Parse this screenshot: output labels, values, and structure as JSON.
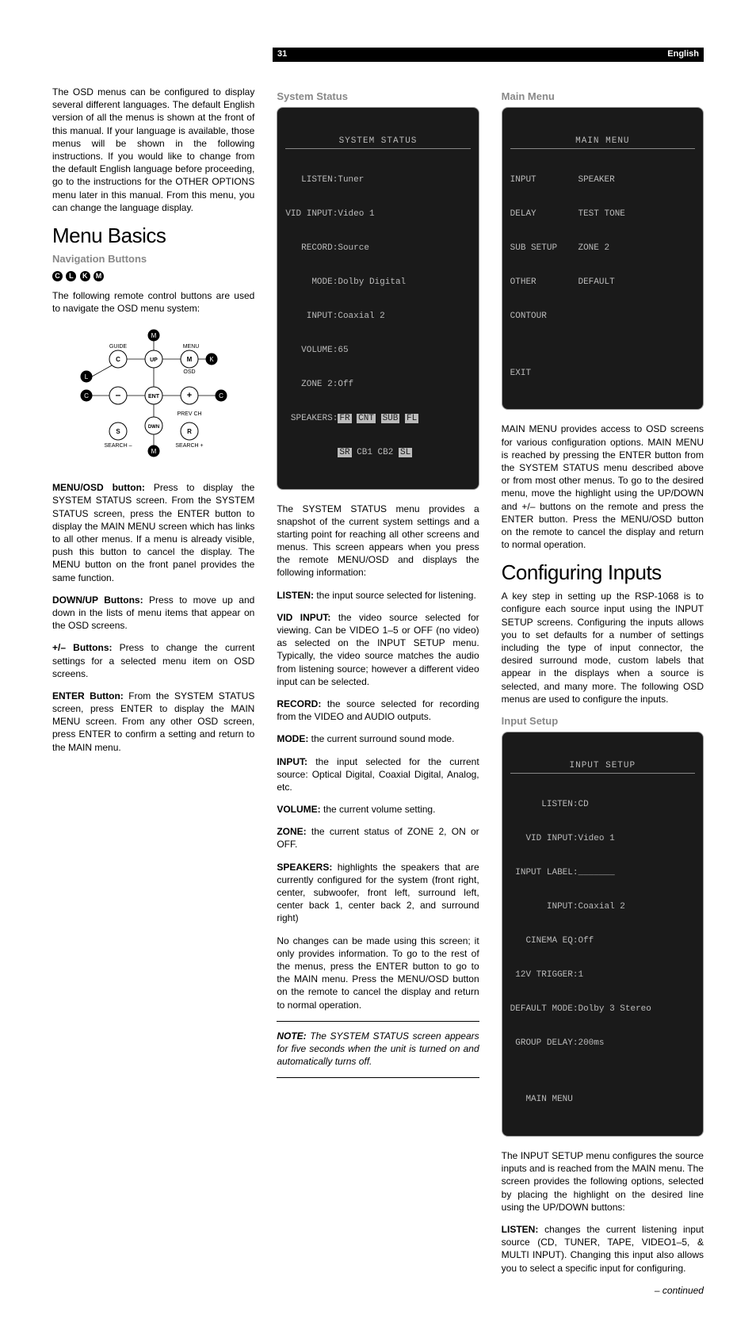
{
  "header": {
    "page_num": "31",
    "language": "English"
  },
  "col1": {
    "intro": "The OSD menus can be configured to display several different languages. The default English version of all the menus is shown at the front of this manual. If your language is available, those menus will be shown in the following instructions. If you would like to change from the default English language before proceeding, go to the instructions for the OTHER OPTIONS menu later in this manual. From this menu, you can change the language display.",
    "h1": "Menu Basics",
    "nav_heading": "Navigation Buttons",
    "nav_circles": [
      "C",
      "L",
      "K",
      "M"
    ],
    "nav_lead": "The following remote control buttons are used to navigate the OSD menu system:",
    "diagram": {
      "labels": [
        "M",
        "M",
        "M",
        "M",
        "C",
        "C",
        "C",
        "L",
        "K",
        "GUIDE",
        "MENU",
        "OSD",
        "UP",
        "ENT",
        "DWN",
        "PREV CH",
        "S",
        "R",
        "SEARCH –",
        "SEARCH +",
        "–",
        "+"
      ]
    },
    "para_menu_b": "MENU/OSD button:",
    "para_menu": " Press to display the SYSTEM STATUS screen. From the SYSTEM STATUS screen, press the ENTER button to display the MAIN MENU screen which has links to all other menus. If a menu is already visible, push this button to cancel the display. The MENU button on the front panel provides the same function.",
    "para_updn_b": "DOWN/UP Buttons:",
    "para_updn": " Press to move up and down in the lists of menu items that appear on the OSD screens.",
    "para_pm_b": "+/– Buttons:",
    "para_pm": " Press to change the current settings for a selected menu item on OSD screens.",
    "para_enter_b": "ENTER Button:",
    "para_enter": " From the SYSTEM STATUS screen, press ENTER to display the MAIN MENU screen. From any other OSD screen, press ENTER to confirm a setting and return to the MAIN menu."
  },
  "col2": {
    "h2": "System Status",
    "osd": {
      "title": "SYSTEM STATUS",
      "lines": [
        "   LISTEN:Tuner",
        "VID INPUT:Video 1",
        "   RECORD:Source",
        "     MODE:Dolby Digital",
        "    INPUT:Coaxial 2",
        "   VOLUME:65",
        "   ZONE 2:Off"
      ],
      "speakers_label": " SPEAKERS:",
      "speakers_row1": [
        "FR",
        "CNT",
        "SUB",
        "FL"
      ],
      "speakers_row2_pre": "          ",
      "speakers_row2_inv1": "SR",
      "speakers_row2_mid": " CB1 CB2 ",
      "speakers_row2_inv2": "SL"
    },
    "p1": "The SYSTEM STATUS menu provides a snapshot of the current system settings and a starting point for reaching all other screens and menus. This screen appears when you press the remote MENU/OSD and displays the following information:",
    "listen_b": "LISTEN:",
    "listen": " the input source selected for listening.",
    "vid_b": "VID INPUT:",
    "vid": " the video source selected for viewing. Can be VIDEO 1–5 or OFF (no video) as selected on the INPUT SETUP menu. Typically, the video source matches the audio from listening source; however a different video input can be selected.",
    "rec_b": "RECORD:",
    "rec": " the source selected for recording from the VIDEO and AUDIO outputs.",
    "mode_b": "MODE:",
    "mode": " the current surround sound mode.",
    "input_b": "INPUT:",
    "input": " the input selected for the current source: Optical Digital, Coaxial Digital, Analog, etc.",
    "vol_b": "VOLUME:",
    "vol": " the current volume setting.",
    "zone_b": "ZONE:",
    "zone": " the current status of ZONE 2, ON or OFF.",
    "spk_b": "SPEAKERS:",
    "spk": " highlights the speakers that are currently configured for the system (front right, center, subwoofer, front left, surround left, center back 1, center back 2, and surround right)",
    "p2": "No changes can be made using this screen; it only provides information. To go to the rest of the menus, press the ENTER button to go to the MAIN menu. Press the MENU/OSD button on the remote to cancel the display and return to normal operation.",
    "note_b": "NOTE:",
    "note": " The SYSTEM STATUS screen appears for five seconds when the unit is turned on and automatically turns off."
  },
  "col3": {
    "h2a": "Main Menu",
    "osd1": {
      "title": "MAIN MENU",
      "left": [
        "INPUT",
        "DELAY",
        "SUB SETUP",
        "OTHER",
        "CONTOUR",
        "",
        "EXIT"
      ],
      "right": [
        "SPEAKER",
        "TEST TONE",
        "ZONE 2",
        "DEFAULT",
        "",
        "",
        ""
      ]
    },
    "p1": "MAIN MENU provides access to OSD screens for various configuration options. MAIN MENU is reached by pressing the ENTER button from the SYSTEM STATUS menu described above or from most other menus. To go to the desired menu, move the highlight using the UP/DOWN and +/– buttons on the remote and press the ENTER button. Press the MENU/OSD button on the remote to cancel the display and return to normal operation.",
    "h1": "Configuring Inputs",
    "p2": "A key step in setting up the RSP-1068 is to configure each source input using the INPUT SETUP screens. Configuring the inputs allows you to set defaults for a number of settings including the type of input connector, the desired surround mode, custom labels that appear in the displays when a source is selected, and many more. The following OSD menus are used to configure the inputs.",
    "h2b": "Input Setup",
    "osd2": {
      "title": "INPUT SETUP",
      "lines": [
        "      LISTEN:CD",
        "   VID INPUT:Video 1",
        " INPUT LABEL:_______",
        "       INPUT:Coaxial 2",
        "   CINEMA EQ:Off",
        " 12V TRIGGER:1",
        "DEFAULT MODE:Dolby 3 Stereo",
        " GROUP DELAY:200ms",
        "",
        "   MAIN MENU"
      ]
    },
    "p3": "The INPUT SETUP menu configures the source inputs and is reached from the MAIN menu. The screen provides the following options, selected by placing the highlight on the desired line using the UP/DOWN buttons:",
    "listen_b": "LISTEN:",
    "listen": " changes the current listening input source (CD, TUNER, TAPE, VIDEO1–5, & MULTI INPUT). Changing this input also allows you to select a specific input for configuring.",
    "continued": "– continued"
  }
}
